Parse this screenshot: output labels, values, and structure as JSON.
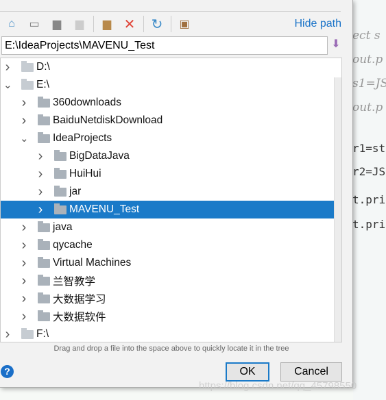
{
  "background_code": [
    "ect s",
    "out.p",
    "s1=JS",
    "out.p",
    "r1=st",
    "r2=JS",
    "t.pri",
    "t.pri"
  ],
  "toolbar": {
    "icons": [
      "home-icon",
      "desktop-icon",
      "project-folder-icon",
      "module-folder-icon",
      "new-folder-icon",
      "delete-icon",
      "refresh-icon",
      "show-hidden-icon"
    ],
    "hide_path": "Hide path"
  },
  "path": {
    "value": "E:\\IdeaProjects\\MAVENU_Test"
  },
  "tree": [
    {
      "label": "D:\\",
      "level": 0,
      "expanded": false,
      "drive": true
    },
    {
      "label": "E:\\",
      "level": 0,
      "expanded": true,
      "drive": true
    },
    {
      "label": "360downloads",
      "level": 1,
      "expanded": false
    },
    {
      "label": "BaiduNetdiskDownload",
      "level": 1,
      "expanded": false
    },
    {
      "label": "IdeaProjects",
      "level": 1,
      "expanded": true
    },
    {
      "label": "BigDataJava",
      "level": 2,
      "expanded": false
    },
    {
      "label": "HuiHui",
      "level": 2,
      "expanded": false
    },
    {
      "label": "jar",
      "level": 2,
      "expanded": false
    },
    {
      "label": "MAVENU_Test",
      "level": 2,
      "expanded": false,
      "selected": true
    },
    {
      "label": "java",
      "level": 1,
      "expanded": false
    },
    {
      "label": "qycache",
      "level": 1,
      "expanded": false
    },
    {
      "label": "Virtual Machines",
      "level": 1,
      "expanded": false
    },
    {
      "label": "兰智教学",
      "level": 1,
      "expanded": false
    },
    {
      "label": "大数据学习",
      "level": 1,
      "expanded": false
    },
    {
      "label": "大数据软件",
      "level": 1,
      "expanded": false
    },
    {
      "label": "F:\\",
      "level": 0,
      "expanded": false,
      "drive": true
    }
  ],
  "hint": "Drag and drop a file into the space above to quickly locate it in the tree",
  "buttons": {
    "ok": "OK",
    "cancel": "Cancel"
  },
  "watermark": "https://blog.csdn.net/qq_45798550",
  "colors": {
    "selection": "#1a7ac8",
    "link": "#1a73c8"
  }
}
